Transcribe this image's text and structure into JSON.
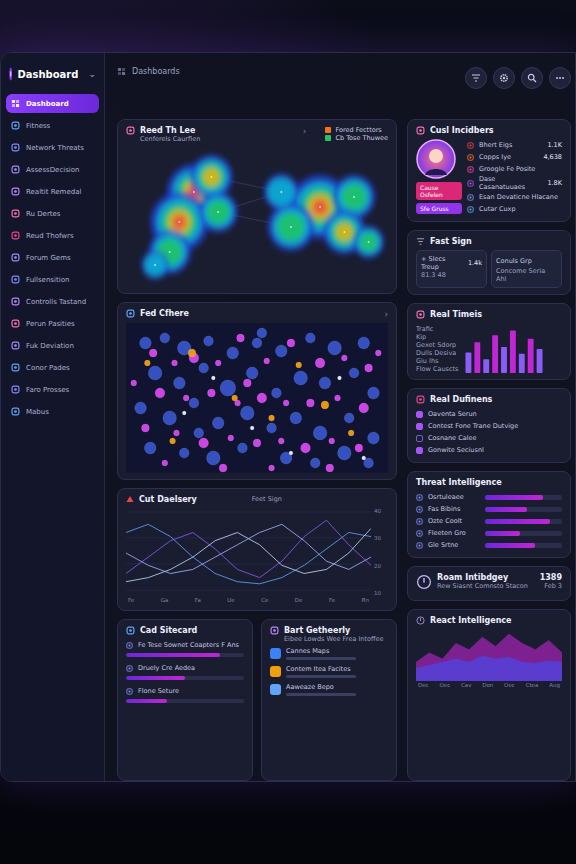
{
  "window": {
    "title": "Dashboard"
  },
  "sidebar": {
    "logo": "Dashboard",
    "collapse": "⌄",
    "items": [
      {
        "label": "Dashboard",
        "selected": true,
        "color": "#ffffff"
      },
      {
        "label": "Fitness",
        "selected": false,
        "color": "#60a5fa"
      },
      {
        "label": "Network Threats",
        "selected": false,
        "color": "#818cf8"
      },
      {
        "label": "AssessDecision",
        "selected": false,
        "color": "#a78bfa"
      },
      {
        "label": "Realtit Remedal",
        "selected": false,
        "color": "#c084fc"
      },
      {
        "label": "Ru Dertes",
        "selected": false,
        "color": "#f472b6"
      },
      {
        "label": "Reud Thofwrs",
        "selected": false,
        "color": "#ec4899"
      },
      {
        "label": "Forum Gems",
        "selected": false,
        "color": "#a78bfa"
      },
      {
        "label": "Fullsensition",
        "selected": false,
        "color": "#818cf8"
      },
      {
        "label": "Controlls Tastand",
        "selected": false,
        "color": "#c084fc"
      },
      {
        "label": "Perun Pasities",
        "selected": false,
        "color": "#f472b6"
      },
      {
        "label": "Fuk Deviation",
        "selected": false,
        "color": "#a78bfa"
      },
      {
        "label": "Conor Pades",
        "selected": false,
        "color": "#60a5fa"
      },
      {
        "label": "Faro Prosses",
        "selected": false,
        "color": "#818cf8"
      },
      {
        "label": "Mabus",
        "selected": false,
        "color": "#60a5fa"
      }
    ]
  },
  "topbar": {
    "breadcrumb": "Dashboards"
  },
  "heatmap": {
    "title": "Reed Th Lee",
    "subtitle": "Cenferels Caurflen",
    "chevron": "›",
    "legend": [
      {
        "label": "Fored Fecttors",
        "color": "#f97316"
      },
      {
        "label": "Cb Tose Thuwee",
        "color": "#22c55e"
      }
    ],
    "spots": [
      [
        70,
        45,
        28,
        0.9
      ],
      [
        55,
        75,
        30,
        0.8
      ],
      [
        88,
        30,
        22,
        0.7
      ],
      [
        45,
        105,
        22,
        0.6
      ],
      [
        95,
        65,
        20,
        0.5
      ],
      [
        200,
        60,
        32,
        0.95
      ],
      [
        170,
        80,
        24,
        0.6
      ],
      [
        235,
        50,
        22,
        0.6
      ],
      [
        225,
        85,
        22,
        0.7
      ],
      [
        160,
        45,
        18,
        0.4
      ],
      [
        250,
        95,
        16,
        0.5
      ],
      [
        30,
        118,
        14,
        0.4
      ]
    ]
  },
  "dotmap": {
    "title": "Fed Cfhere",
    "chevron": "›",
    "groups": [
      {
        "color": "#3b5bdb",
        "dots": [
          [
            20,
            20,
            6
          ],
          [
            40,
            15,
            5
          ],
          [
            60,
            25,
            7
          ],
          [
            85,
            18,
            5
          ],
          [
            110,
            30,
            6
          ],
          [
            135,
            20,
            5
          ],
          [
            160,
            28,
            6
          ],
          [
            190,
            15,
            5
          ],
          [
            215,
            25,
            7
          ],
          [
            245,
            20,
            6
          ],
          [
            30,
            50,
            7
          ],
          [
            55,
            60,
            6
          ],
          [
            80,
            45,
            5
          ],
          [
            105,
            65,
            8
          ],
          [
            130,
            50,
            6
          ],
          [
            155,
            70,
            5
          ],
          [
            180,
            55,
            7
          ],
          [
            205,
            60,
            6
          ],
          [
            235,
            50,
            5
          ],
          [
            255,
            70,
            6
          ],
          [
            15,
            85,
            6
          ],
          [
            45,
            95,
            7
          ],
          [
            70,
            80,
            5
          ],
          [
            95,
            100,
            6
          ],
          [
            125,
            90,
            7
          ],
          [
            150,
            105,
            5
          ],
          [
            175,
            95,
            6
          ],
          [
            200,
            110,
            7
          ],
          [
            230,
            95,
            5
          ],
          [
            255,
            115,
            6
          ],
          [
            25,
            125,
            6
          ],
          [
            60,
            130,
            5
          ],
          [
            90,
            135,
            7
          ],
          [
            120,
            125,
            5
          ],
          [
            165,
            135,
            6
          ],
          [
            195,
            140,
            5
          ],
          [
            225,
            130,
            7
          ],
          [
            250,
            140,
            5
          ],
          [
            140,
            10,
            5
          ],
          [
            75,
            110,
            5
          ]
        ]
      },
      {
        "color": "#d946ef",
        "dots": [
          [
            28,
            30,
            4
          ],
          [
            50,
            40,
            3
          ],
          [
            70,
            35,
            5
          ],
          [
            95,
            40,
            3
          ],
          [
            118,
            15,
            4
          ],
          [
            145,
            38,
            3
          ],
          [
            170,
            20,
            4
          ],
          [
            200,
            40,
            5
          ],
          [
            225,
            35,
            3
          ],
          [
            250,
            45,
            4
          ],
          [
            35,
            70,
            5
          ],
          [
            62,
            75,
            3
          ],
          [
            88,
            70,
            4
          ],
          [
            115,
            80,
            3
          ],
          [
            140,
            75,
            5
          ],
          [
            165,
            80,
            3
          ],
          [
            190,
            80,
            4
          ],
          [
            218,
            75,
            3
          ],
          [
            245,
            85,
            5
          ],
          [
            20,
            105,
            4
          ],
          [
            52,
            110,
            3
          ],
          [
            80,
            120,
            5
          ],
          [
            108,
            115,
            3
          ],
          [
            135,
            120,
            4
          ],
          [
            160,
            118,
            3
          ],
          [
            185,
            125,
            5
          ],
          [
            212,
            118,
            3
          ],
          [
            240,
            125,
            4
          ],
          [
            40,
            140,
            3
          ],
          [
            100,
            145,
            4
          ],
          [
            150,
            145,
            3
          ],
          [
            210,
            145,
            4
          ],
          [
            260,
            30,
            3
          ],
          [
            125,
            60,
            4
          ],
          [
            8,
            60,
            3
          ]
        ]
      },
      {
        "color": "#f59e0b",
        "dots": [
          [
            68,
            30,
            4
          ],
          [
            112,
            75,
            3
          ],
          [
            205,
            82,
            4
          ],
          [
            232,
            110,
            3
          ],
          [
            48,
            118,
            3
          ],
          [
            178,
            42,
            3
          ],
          [
            150,
            95,
            3
          ],
          [
            22,
            40,
            3
          ]
        ]
      },
      {
        "color": "#f1f5ff",
        "dots": [
          [
            90,
            55,
            2
          ],
          [
            130,
            105,
            2
          ],
          [
            220,
            55,
            2
          ],
          [
            60,
            90,
            2
          ],
          [
            245,
            135,
            2
          ],
          [
            170,
            130,
            2
          ]
        ]
      }
    ]
  },
  "linechart": {
    "title": "Cut Daelsery",
    "subtitle": "Feet Sign",
    "y_ticks": [
      "40",
      "30",
      "20",
      "10"
    ],
    "x_labels": [
      "Fe",
      "Ga",
      "Fa",
      "Ue",
      "Ce",
      "De",
      "Fe",
      "Rn"
    ],
    "series": [
      {
        "color": "#60a5fa",
        "values": [
          30,
          34,
          28,
          18,
          10,
          6,
          5,
          8,
          14,
          22,
          30,
          28
        ]
      },
      {
        "color": "#8b5cf6",
        "values": [
          10,
          18,
          26,
          30,
          22,
          12,
          8,
          16,
          28,
          36,
          24,
          14
        ]
      },
      {
        "color": "#bfdbfe",
        "values": [
          6,
          8,
          12,
          18,
          26,
          30,
          24,
          14,
          10,
          12,
          20,
          32
        ]
      },
      {
        "color": "#a5b4fc",
        "values": [
          20,
          14,
          10,
          12,
          18,
          24,
          30,
          34,
          26,
          16,
          12,
          18
        ]
      }
    ]
  },
  "list_card": {
    "title": "Cad Sitecard",
    "items": [
      {
        "label": "Fe Tese Sownet Coapters F Ans",
        "level": 0.8
      },
      {
        "label": "Druely Cre Aedea",
        "level": 0.5
      },
      {
        "label": "Flone Seture",
        "level": 0.35
      }
    ]
  },
  "activity_card": {
    "title": "Bart Getheerly",
    "subtitle": "Eibee Lowds Wee Frea Intoffee",
    "items": [
      {
        "label": "Cannes Maps",
        "color": "#3b82f6"
      },
      {
        "label": "Contem Itea Facites",
        "color": "#f59e0b"
      },
      {
        "label": "Aaweaze Bepo",
        "color": "#60a5fa"
      }
    ]
  },
  "incidents": {
    "title": "Cusl Incidbers",
    "rows": [
      {
        "label": "Bhert Eigs",
        "value": "1.1K",
        "color": "#ef4444"
      },
      {
        "label": "Copps Iye",
        "value": "4,638",
        "color": "#f97316"
      },
      {
        "label": "Groogle Fe Posite",
        "value": "",
        "color": "#ec4899"
      },
      {
        "label": "Dase Casanatuuaes",
        "value": "1.8K",
        "color": "#a855f7"
      },
      {
        "label": "Esan Devaticne Hlacane",
        "value": "",
        "color": "#818cf8"
      },
      {
        "label": "Cutar Cuxp",
        "value": "",
        "color": "#60a5fa"
      }
    ],
    "tags": [
      {
        "label": "Cause Osfelen",
        "color": "#db2777"
      },
      {
        "label": "Sfe Gruss",
        "color": "#9333ea"
      }
    ]
  },
  "fast_sign": {
    "title": "Fast Sign",
    "items": [
      {
        "label": "+ Slecs Treup",
        "value": "1.4k",
        "sub": "81.3 48"
      },
      {
        "label": "Conuls Grp",
        "value": "",
        "sub": "Concome Seria Ahl"
      }
    ]
  },
  "realtime": {
    "title": "Real Timeis",
    "lines": [
      "Trafic",
      "Kip",
      "Gexet Sdorp",
      "Dulls Desiva",
      "Giu Ihs",
      "Flow Causcts"
    ],
    "bars": [
      30,
      45,
      20,
      55,
      38,
      62,
      28,
      50,
      35
    ]
  },
  "definitions": {
    "title": "Real Dufinens",
    "items": [
      {
        "label": "Oaventa Serun",
        "checked": true
      },
      {
        "label": "Contest Fone Trane Dutvige",
        "checked": true
      },
      {
        "label": "Cosnane Calee",
        "checked": false
      },
      {
        "label": "Gonwite Seciusnl",
        "checked": true
      }
    ]
  },
  "threat": {
    "title": "Threat Intelligence",
    "rows": [
      {
        "label": "Osrtuleaee",
        "level": 0.75
      },
      {
        "label": "Fas Bibins",
        "level": 0.55
      },
      {
        "label": "Ozte Coolt",
        "level": 0.85
      },
      {
        "label": "Fleeten Gro",
        "level": 0.45
      },
      {
        "label": "Gle Srtne",
        "level": 0.65
      }
    ]
  },
  "roam": {
    "title": "Roam Intibdgey",
    "subtitle": "Rew Siasnt Comnsto Stacon",
    "value": "1389",
    "sub": "Feb 3"
  },
  "react": {
    "title": "React Intelligence",
    "x_labels": [
      "Dec",
      "Oec",
      "Cav",
      "Don",
      "Oec",
      "Ctea",
      "Aug"
    ],
    "series": [
      {
        "color": "#c026d3",
        "values": [
          30,
          45,
          35,
          60,
          50,
          70,
          55,
          75,
          60,
          50,
          65,
          45
        ]
      },
      {
        "color": "#4f46e5",
        "values": [
          20,
          25,
          30,
          35,
          30,
          40,
          35,
          38,
          30,
          28,
          32,
          30
        ]
      }
    ]
  }
}
